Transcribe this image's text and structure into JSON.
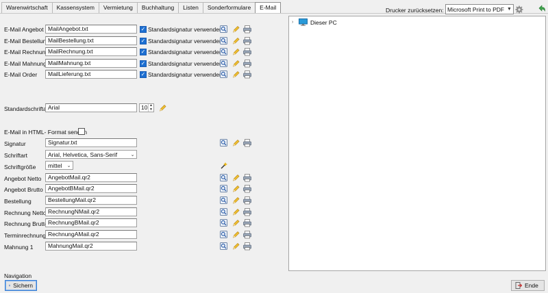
{
  "tabs": [
    "Warenwirtschaft",
    "Kassensystem",
    "Vermietung",
    "Buchhaltung",
    "Listen",
    "Sonderformulare",
    "E-Mail"
  ],
  "active_tab": "E-Mail",
  "printer": {
    "label": "Drucker zurücksetzen:",
    "value": "Microsoft Print to PDF"
  },
  "mail_rows": [
    {
      "label": "E-Mail Angebot",
      "file": "MailAngebot.txt",
      "checkbox": "Standardsignatur verwenden",
      "checked": true
    },
    {
      "label": "E-Mail Bestellung",
      "file": "MailBestellung.txt",
      "checkbox": "Standardsignatur verwenden",
      "checked": true
    },
    {
      "label": "E-Mail Rechnung",
      "file": "MailRechnung.txt",
      "checkbox": "Standardsignatur verwenden",
      "checked": true
    },
    {
      "label": "E-Mail Mahnung",
      "file": "MailMahnung.txt",
      "checkbox": "Standardsignatur verwenden",
      "checked": true
    },
    {
      "label": "E-Mail Order",
      "file": "MailLieferung.txt",
      "checkbox": "Standardsignatur verwenden",
      "checked": true
    }
  ],
  "std_font": {
    "label": "Standardschriftart",
    "value": "Arial",
    "size": "10"
  },
  "html_format": {
    "label": "E-Mail in HTML- Format senden",
    "checked": false
  },
  "signature": {
    "label": "Signatur",
    "value": "Signatur.txt"
  },
  "font_family": {
    "label": "Schriftart",
    "value": "Arial, Helvetica, Sans-Serif"
  },
  "font_size": {
    "label": "Schriftgröße",
    "value": "mittel"
  },
  "template_rows": [
    {
      "label": "Angebot Netto",
      "file": "AngebotMail.qr2"
    },
    {
      "label": "Angebot Brutto",
      "file": "AngebotBMail.qr2"
    },
    {
      "label": "Bestellung",
      "file": "BestellungMail.qr2"
    },
    {
      "label": "Rechnung Netto",
      "file": "RechnungNMail.qr2"
    },
    {
      "label": "Rechnung Brutto",
      "file": "RechnungBMail.qr2"
    },
    {
      "label": "Terminrechnung",
      "file": "RechnungAMail.qr2"
    },
    {
      "label": "Mahnung 1",
      "file": "MahnungMail.qr2"
    }
  ],
  "tree": {
    "root": "Dieser PC"
  },
  "navigation_label": "Navigation",
  "save_label": "Sichern",
  "end_label": "Ende"
}
